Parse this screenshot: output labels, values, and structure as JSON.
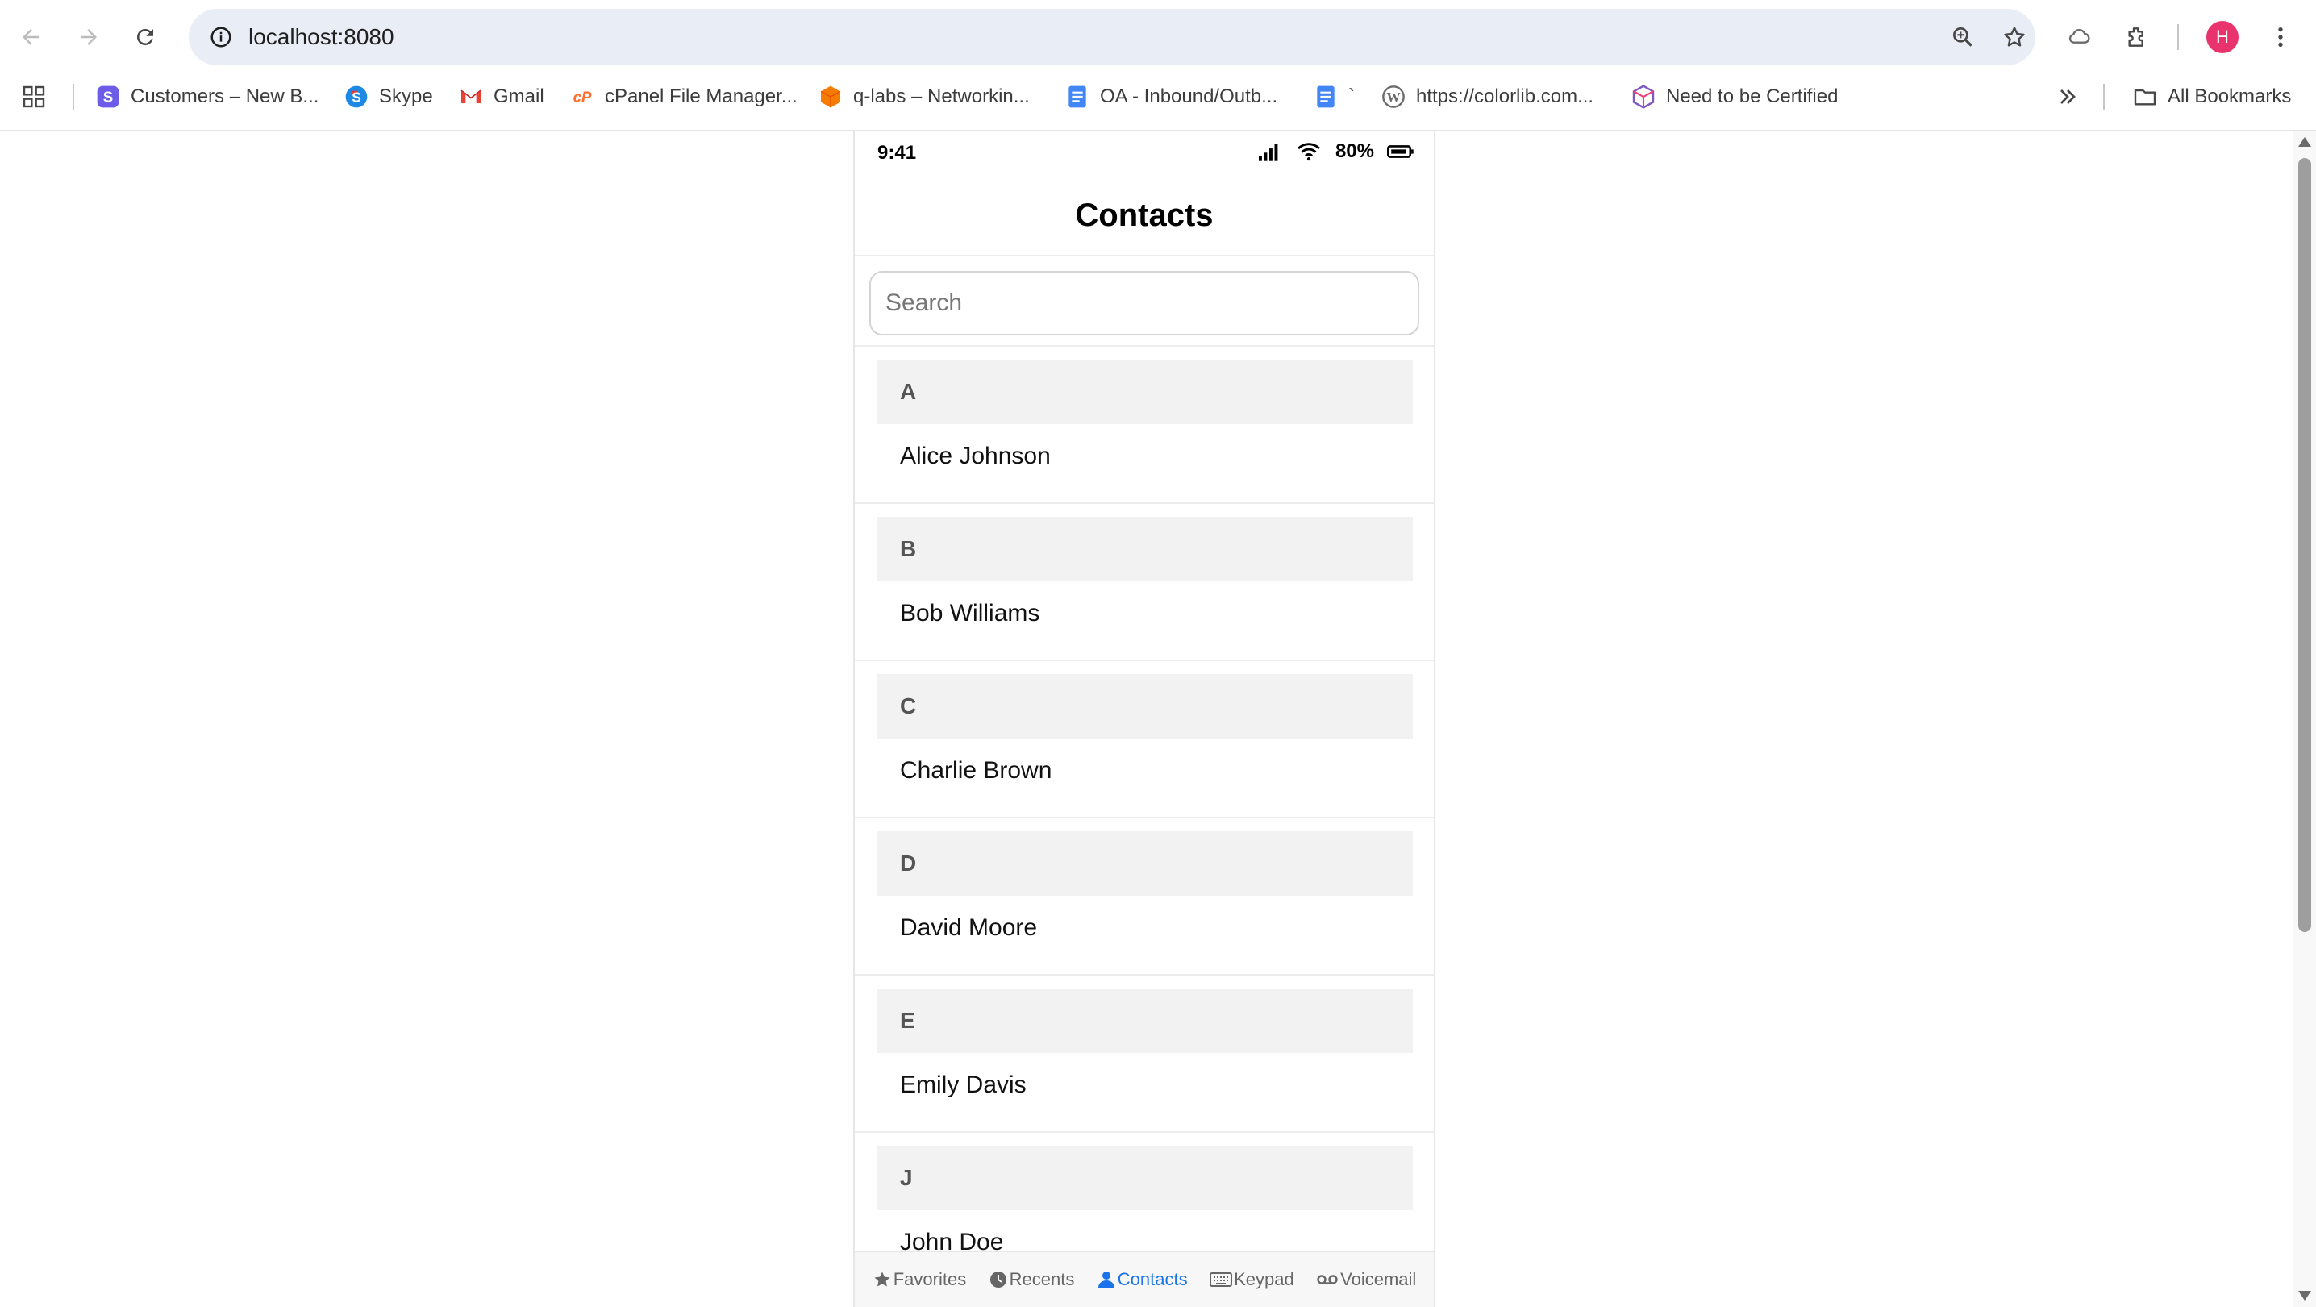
{
  "browser": {
    "url": "localhost:8080",
    "profile_initial": "H",
    "bookmarks": [
      {
        "label": "Customers – New B...",
        "icon": "s-app-icon"
      },
      {
        "label": "Skype",
        "icon": "skype-icon"
      },
      {
        "label": "Gmail",
        "icon": "gmail-icon"
      },
      {
        "label": "cPanel File Manager...",
        "icon": "cpanel-icon"
      },
      {
        "label": "q-labs – Networkin...",
        "icon": "cube-icon"
      },
      {
        "label": "OA - Inbound/Outb...",
        "icon": "docs-icon"
      },
      {
        "label": "`",
        "icon": "docs-icon"
      },
      {
        "label": "https://colorlib.com...",
        "icon": "wordpress-icon"
      },
      {
        "label": "Need to be Certified",
        "icon": "box-icon"
      }
    ],
    "all_bookmarks_label": "All Bookmarks"
  },
  "colors": {
    "accent": "#1a73e8",
    "section_bg": "#f2f2f2",
    "avatar": "#e8336c"
  },
  "phone": {
    "status": {
      "time": "9:41",
      "battery": "80%"
    },
    "title": "Contacts",
    "search": {
      "placeholder": "Search",
      "value": ""
    },
    "sections": [
      {
        "letter": "A",
        "contacts": [
          "Alice Johnson"
        ]
      },
      {
        "letter": "B",
        "contacts": [
          "Bob Williams"
        ]
      },
      {
        "letter": "C",
        "contacts": [
          "Charlie Brown"
        ]
      },
      {
        "letter": "D",
        "contacts": [
          "David Moore"
        ]
      },
      {
        "letter": "E",
        "contacts": [
          "Emily Davis"
        ]
      },
      {
        "letter": "J",
        "contacts": [
          "John Doe"
        ]
      }
    ],
    "tabs": [
      {
        "label": "Favorites",
        "icon": "star-icon",
        "active": false
      },
      {
        "label": "Recents",
        "icon": "clock-icon",
        "active": false
      },
      {
        "label": "Contacts",
        "icon": "person-icon",
        "active": true
      },
      {
        "label": "Keypad",
        "icon": "keyboard-icon",
        "active": false
      },
      {
        "label": "Voicemail",
        "icon": "voicemail-icon",
        "active": false
      }
    ]
  }
}
